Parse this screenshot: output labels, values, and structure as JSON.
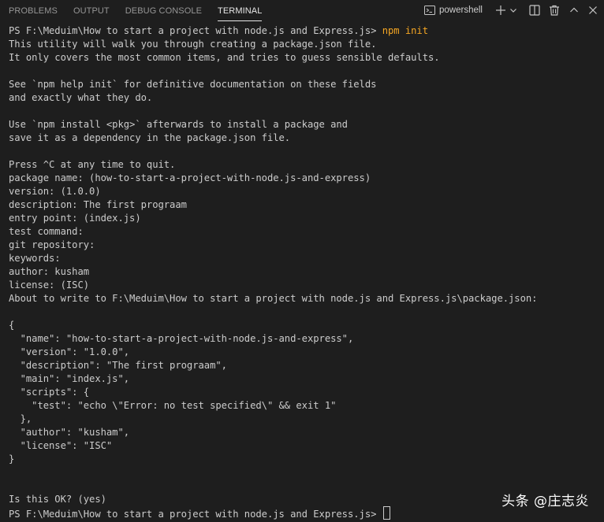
{
  "tabs": [
    {
      "label": "PROBLEMS"
    },
    {
      "label": "OUTPUT"
    },
    {
      "label": "DEBUG CONSOLE"
    },
    {
      "label": "TERMINAL",
      "active": true
    }
  ],
  "shell": {
    "label": "powershell"
  },
  "icons": {
    "terminal": "terminal-icon",
    "new": "plus-icon",
    "dropdown": "chevron-down-icon",
    "split": "split-icon",
    "trash": "trash-icon",
    "collapse": "chevron-up-icon",
    "close": "close-icon"
  },
  "colors": {
    "background": "#1e1e1e",
    "text": "#cccccc",
    "command": "#f5a623"
  },
  "terminal": {
    "prompt": "PS F:\\Meduim\\How to start a project with node.js and Express.js> ",
    "command": "npm init",
    "lines": [
      "This utility will walk you through creating a package.json file.",
      "It only covers the most common items, and tries to guess sensible defaults.",
      "",
      "See `npm help init` for definitive documentation on these fields",
      "and exactly what they do.",
      "",
      "Use `npm install <pkg>` afterwards to install a package and",
      "save it as a dependency in the package.json file.",
      "",
      "Press ^C at any time to quit.",
      "package name: (how-to-start-a-project-with-node.js-and-express)",
      "version: (1.0.0)",
      "description: The first prograam",
      "entry point: (index.js)",
      "test command:",
      "git repository:",
      "keywords:",
      "author: kusham",
      "license: (ISC)",
      "About to write to F:\\Meduim\\How to start a project with node.js and Express.js\\package.json:",
      "",
      "{",
      "  \"name\": \"how-to-start-a-project-with-node.js-and-express\",",
      "  \"version\": \"1.0.0\",",
      "  \"description\": \"The first prograam\",",
      "  \"main\": \"index.js\",",
      "  \"scripts\": {",
      "    \"test\": \"echo \\\"Error: no test specified\\\" && exit 1\"",
      "  },",
      "  \"author\": \"kusham\",",
      "  \"license\": \"ISC\"",
      "}",
      "",
      "",
      "Is this OK? (yes)"
    ],
    "final_prompt": "PS F:\\Meduim\\How to start a project with node.js and Express.js> "
  },
  "watermark": "头条 @庄志炎"
}
